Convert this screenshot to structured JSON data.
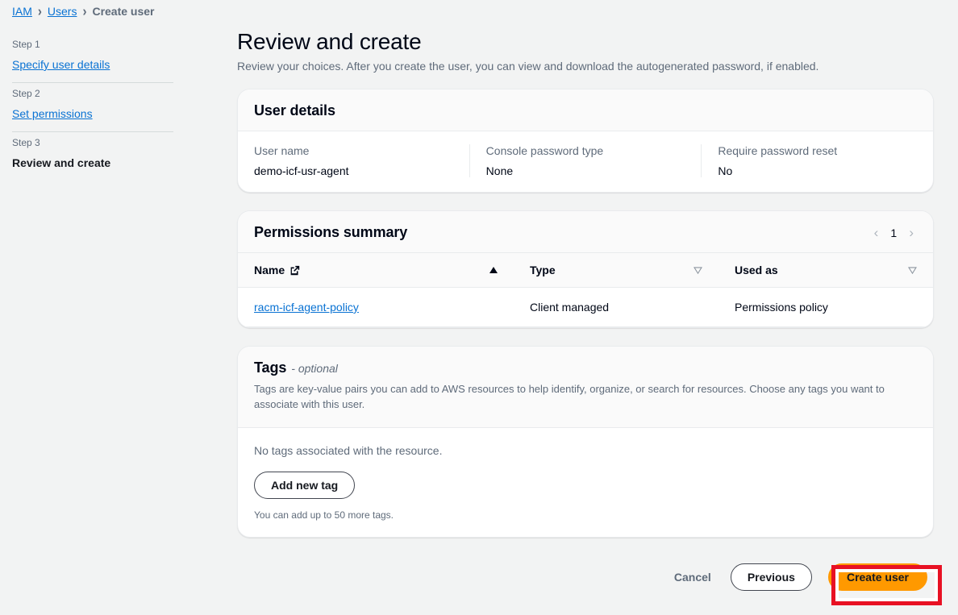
{
  "breadcrumb": {
    "items": [
      {
        "label": "IAM",
        "type": "link"
      },
      {
        "label": "Users",
        "type": "link"
      },
      {
        "label": "Create user",
        "type": "current"
      }
    ],
    "separator": "›"
  },
  "wizard": {
    "steps": [
      {
        "step_label": "Step 1",
        "title": "Specify user details",
        "state": "link"
      },
      {
        "step_label": "Step 2",
        "title": "Set permissions",
        "state": "link"
      },
      {
        "step_label": "Step 3",
        "title": "Review and create",
        "state": "active"
      }
    ]
  },
  "page": {
    "title": "Review and create",
    "subtitle": "Review your choices. After you create the user, you can view and download the autogenerated password, if enabled."
  },
  "user_details": {
    "card_title": "User details",
    "fields": [
      {
        "key": "User name",
        "value": "demo-icf-usr-agent"
      },
      {
        "key": "Console password type",
        "value": "None"
      },
      {
        "key": "Require password reset",
        "value": "No"
      }
    ]
  },
  "permissions": {
    "card_title": "Permissions summary",
    "pagination": {
      "prev_icon": "chevron-left-icon",
      "page": "1",
      "next_icon": "chevron-right-icon"
    },
    "columns": [
      {
        "label": "Name",
        "has_external_link_icon": true,
        "sort": "asc"
      },
      {
        "label": "Type",
        "has_external_link_icon": false,
        "sort": "none"
      },
      {
        "label": "Used as",
        "has_external_link_icon": false,
        "sort": "none"
      }
    ],
    "rows": [
      {
        "name": "racm-icf-agent-policy",
        "type": "Client managed",
        "used_as": "Permissions policy"
      }
    ]
  },
  "tags": {
    "title": "Tags",
    "optional_label": "- optional",
    "description": "Tags are key-value pairs you can add to AWS resources to help identify, organize, or search for resources. Choose any tags you want to associate with this user.",
    "empty_message": "No tags associated with the resource.",
    "add_button": "Add new tag",
    "hint": "You can add up to 50 more tags."
  },
  "footer": {
    "cancel": "Cancel",
    "previous": "Previous",
    "create": "Create user"
  },
  "colors": {
    "page_background": "#f2f3f3",
    "card_background": "#ffffff",
    "link": "#0972d3",
    "primary_button": "#ff9900",
    "annotation_highlight": "#e81123",
    "muted_text": "#5f6b7a"
  }
}
